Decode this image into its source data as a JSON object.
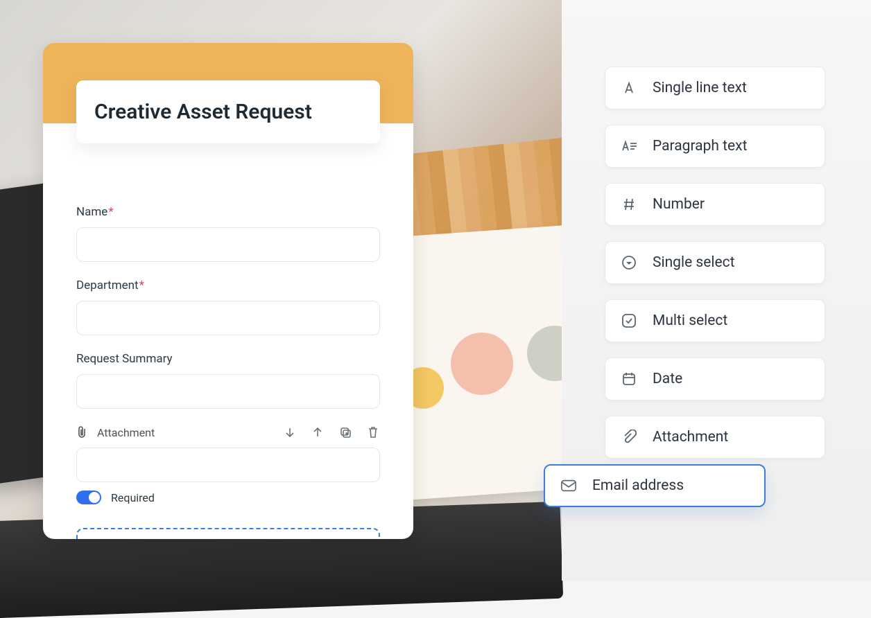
{
  "form": {
    "title": "Creative Asset Request",
    "fields": {
      "name": {
        "label": "Name",
        "required": true
      },
      "department": {
        "label": "Department",
        "required": true
      },
      "summary": {
        "label": "Request Summary",
        "required": false
      }
    },
    "attachment": {
      "label": "Attachment",
      "required_label": "Required",
      "required_on": true
    }
  },
  "palette": {
    "items": [
      {
        "key": "single_line",
        "label": "Single line text"
      },
      {
        "key": "paragraph",
        "label": "Paragraph text"
      },
      {
        "key": "number",
        "label": "Number"
      },
      {
        "key": "single_sel",
        "label": "Single select"
      },
      {
        "key": "multi_sel",
        "label": "Multi select"
      },
      {
        "key": "date",
        "label": "Date"
      },
      {
        "key": "attachment",
        "label": "Attachment"
      }
    ],
    "dragging": {
      "label": "Email address"
    }
  }
}
